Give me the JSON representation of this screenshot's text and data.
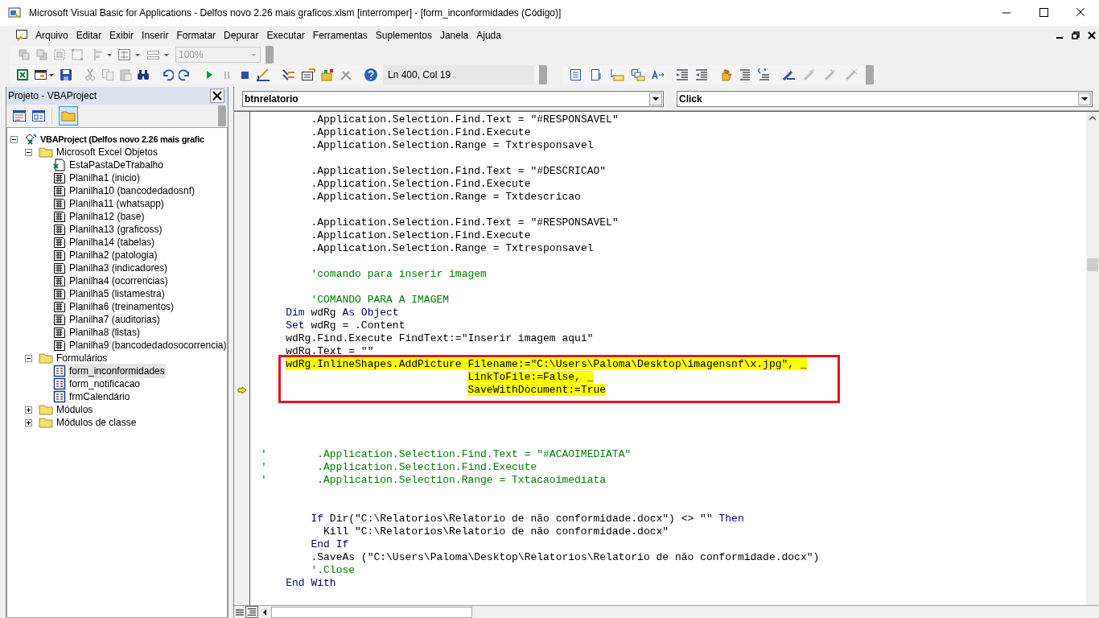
{
  "window": {
    "title": "Microsoft Visual Basic for Applications - Delfos novo 2.26 mais graficos.xlsm [interromper] - [form_inconformidades (Código)]"
  },
  "menu": [
    {
      "label": "Arquivo"
    },
    {
      "label": "Editar"
    },
    {
      "label": "Exibir"
    },
    {
      "label": "Inserir"
    },
    {
      "label": "Formatar"
    },
    {
      "label": "Depurar"
    },
    {
      "label": "Executar"
    },
    {
      "label": "Ferramentas"
    },
    {
      "label": "Suplementos"
    },
    {
      "label": "Janela"
    },
    {
      "label": "Ajuda"
    }
  ],
  "toolbar": {
    "zoom_box": {
      "value": "100%",
      "disabled": true
    },
    "position": "Ln 400, Col 19"
  },
  "project_panel": {
    "title": "Projeto - VBAProject",
    "tree": [
      {
        "label": "VBAProject (Delfos novo 2.26 mais grafic",
        "kind": "project",
        "expanded": true,
        "selected": false,
        "children": [
          {
            "label": "Microsoft Excel Objetos",
            "kind": "folder",
            "expanded": true,
            "selected": false,
            "children": [
              {
                "label": "EstaPastaDeTrabalho",
                "kind": "workbook",
                "selected": false
              },
              {
                "label": "Planilha1 (inicio)",
                "kind": "sheet",
                "selected": false
              },
              {
                "label": "Planilha10 (bancodedadosnf)",
                "kind": "sheet",
                "selected": false
              },
              {
                "label": "Planilha11 (whatsapp)",
                "kind": "sheet",
                "selected": false
              },
              {
                "label": "Planilha12 (base)",
                "kind": "sheet",
                "selected": false
              },
              {
                "label": "Planilha13 (graficoss)",
                "kind": "sheet",
                "selected": false
              },
              {
                "label": "Planilha14 (tabelas)",
                "kind": "sheet",
                "selected": false
              },
              {
                "label": "Planilha2 (patologia)",
                "kind": "sheet",
                "selected": false
              },
              {
                "label": "Planilha3 (indicadores)",
                "kind": "sheet",
                "selected": false
              },
              {
                "label": "Planilha4 (ocorrencias)",
                "kind": "sheet",
                "selected": false
              },
              {
                "label": "Planilha5 (listamestra)",
                "kind": "sheet",
                "selected": false
              },
              {
                "label": "Planilha6 (treinamentos)",
                "kind": "sheet",
                "selected": false
              },
              {
                "label": "Planilha7 (auditorias)",
                "kind": "sheet",
                "selected": false
              },
              {
                "label": "Planilha8 (listas)",
                "kind": "sheet",
                "selected": false
              },
              {
                "label": "Planilha9 (bancodedadosocorrencia)",
                "kind": "sheet",
                "selected": false
              }
            ]
          },
          {
            "label": "Formulários",
            "kind": "folder",
            "expanded": true,
            "selected": false,
            "children": [
              {
                "label": "form_inconformidades",
                "kind": "form",
                "selected": true
              },
              {
                "label": "form_notificacao",
                "kind": "form",
                "selected": false
              },
              {
                "label": "frmCalendário",
                "kind": "form",
                "selected": false
              }
            ]
          },
          {
            "label": "Módulos",
            "kind": "folder",
            "expanded": false,
            "selected": false
          },
          {
            "label": "Módulos de classe",
            "kind": "folder",
            "expanded": false,
            "selected": false
          }
        ]
      }
    ]
  },
  "code_window": {
    "object_box": "btnrelatorio",
    "procedure_box": "Click",
    "lines": [
      {
        "kind": "code",
        "tokens": [
          {
            "kind": "code",
            "text": "        .Application.Selection.Find.Text = \"#RESPONSAVEL\""
          }
        ]
      },
      {
        "kind": "code",
        "tokens": [
          {
            "kind": "code",
            "text": "        .Application.Selection.Find.Execute"
          }
        ]
      },
      {
        "kind": "code",
        "tokens": [
          {
            "kind": "code",
            "text": "        .Application.Selection.Range = Txtresponsavel"
          }
        ]
      },
      {
        "kind": "blank"
      },
      {
        "kind": "code",
        "tokens": [
          {
            "kind": "code",
            "text": "        .Application.Selection.Find.Text = \"#DESCRICAO\""
          }
        ]
      },
      {
        "kind": "code",
        "tokens": [
          {
            "kind": "code",
            "text": "        .Application.Selection.Find.Execute"
          }
        ]
      },
      {
        "kind": "code",
        "tokens": [
          {
            "kind": "code",
            "text": "        .Application.Selection.Range = Txtdescricao"
          }
        ]
      },
      {
        "kind": "blank"
      },
      {
        "kind": "code",
        "tokens": [
          {
            "kind": "code",
            "text": "        .Application.Selection.Find.Text = \"#RESPONSAVEL\""
          }
        ]
      },
      {
        "kind": "code",
        "tokens": [
          {
            "kind": "code",
            "text": "        .Application.Selection.Find.Execute"
          }
        ]
      },
      {
        "kind": "code",
        "tokens": [
          {
            "kind": "code",
            "text": "        .Application.Selection.Range = Txtresponsavel"
          }
        ]
      },
      {
        "kind": "blank"
      },
      {
        "kind": "code",
        "tokens": [
          {
            "kind": "comment",
            "text": "        'comando para inserir imagem"
          }
        ]
      },
      {
        "kind": "blank"
      },
      {
        "kind": "code",
        "tokens": [
          {
            "kind": "comment",
            "text": "        'COMANDO PARA A IMAGEM"
          }
        ]
      },
      {
        "kind": "code",
        "tokens": [
          {
            "kind": "keyword",
            "text": "    Dim"
          },
          {
            "kind": "code",
            "text": " wdRg "
          },
          {
            "kind": "keyword",
            "text": "As Object"
          }
        ]
      },
      {
        "kind": "code",
        "tokens": [
          {
            "kind": "keyword",
            "text": "    Set"
          },
          {
            "kind": "code",
            "text": " wdRg = .Content"
          }
        ]
      },
      {
        "kind": "code",
        "tokens": [
          {
            "kind": "code",
            "text": "    wdRg.Find.Execute FindText:=\"Inserir imagem aqui\""
          }
        ]
      },
      {
        "kind": "code",
        "tokens": [
          {
            "kind": "code",
            "text": "    wdRg.Text = \"\""
          }
        ]
      },
      {
        "kind": "code",
        "highlighted": true,
        "boxed": true,
        "tokens": [
          {
            "kind": "code",
            "text": "    wdRg.InlineShapes.AddPicture Filename:=\"C:\\Users\\Paloma\\Desktop\\imagensnf\\x.jpg\", _"
          }
        ]
      },
      {
        "kind": "code",
        "highlighted": true,
        "boxed": true,
        "tokens": [
          {
            "kind": "code",
            "text": "                                 LinkToFile:=False, _"
          }
        ]
      },
      {
        "kind": "code",
        "highlighted": true,
        "boxed": true,
        "current": true,
        "tokens": [
          {
            "kind": "code",
            "text": "                                 SaveWithDocument:=True"
          }
        ]
      },
      {
        "kind": "blank"
      },
      {
        "kind": "blank"
      },
      {
        "kind": "blank"
      },
      {
        "kind": "blank"
      },
      {
        "kind": "code",
        "tokens": [
          {
            "kind": "comment",
            "text": "'        .Application.Selection.Find.Text = \"#ACAOIMEDIATA\""
          }
        ]
      },
      {
        "kind": "code",
        "tokens": [
          {
            "kind": "comment",
            "text": "'        .Application.Selection.Find.Execute"
          }
        ]
      },
      {
        "kind": "code",
        "tokens": [
          {
            "kind": "comment",
            "text": "'        .Application.Selection.Range = Txtacaoimediata"
          }
        ]
      },
      {
        "kind": "blank"
      },
      {
        "kind": "blank"
      },
      {
        "kind": "code",
        "tokens": [
          {
            "kind": "keyword",
            "text": "        If"
          },
          {
            "kind": "code",
            "text": " Dir(\"C:\\Relatorios\\Relatorio de não conformidade.docx\") <> \"\" "
          },
          {
            "kind": "keyword",
            "text": "Then"
          }
        ]
      },
      {
        "kind": "code",
        "tokens": [
          {
            "kind": "code",
            "text": "          Kill \"C:\\Relatorios\\Relatorio de não conformidade.docx\""
          }
        ]
      },
      {
        "kind": "code",
        "tokens": [
          {
            "kind": "keyword",
            "text": "        End If"
          }
        ]
      },
      {
        "kind": "code",
        "tokens": [
          {
            "kind": "code",
            "text": "        .SaveAs (\"C:\\Users\\Paloma\\Desktop\\Relatorios\\Relatorio de não conformidade.docx\")"
          }
        ]
      },
      {
        "kind": "code",
        "tokens": [
          {
            "kind": "comment",
            "text": "        '.Close"
          }
        ]
      },
      {
        "kind": "code",
        "tokens": [
          {
            "kind": "keyword",
            "text": "    End With"
          }
        ]
      }
    ]
  }
}
